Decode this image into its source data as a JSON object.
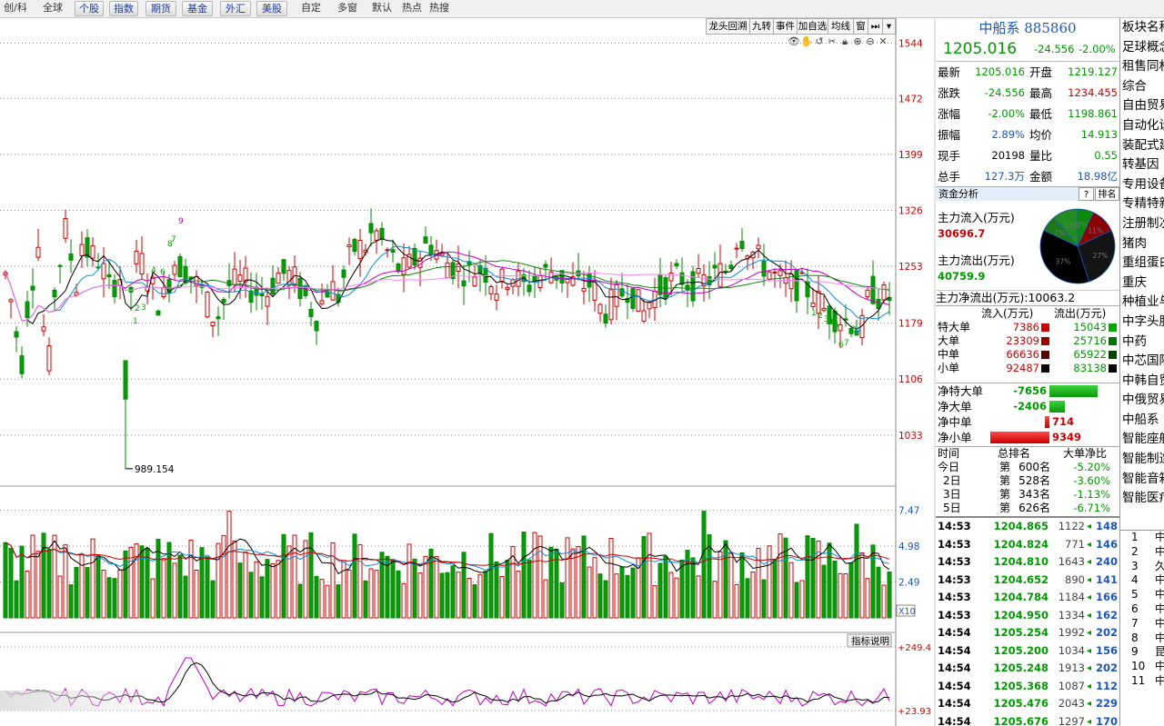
{
  "toolbar": {
    "items": [
      {
        "label": "创/科",
        "style": "plain"
      },
      {
        "label": "全球",
        "style": "plain"
      },
      {
        "label": "个股",
        "style": "btn"
      },
      {
        "label": "指数",
        "style": "btn"
      },
      {
        "label": "期货",
        "style": "btn"
      },
      {
        "label": "基金",
        "style": "btn"
      },
      {
        "label": "外汇",
        "style": "btn"
      },
      {
        "label": "美股",
        "style": "btn"
      },
      {
        "label": "自定",
        "style": "plain"
      },
      {
        "label": "多窗",
        "style": "plain"
      },
      {
        "label": "默认",
        "style": "plain"
      },
      {
        "label": "热点",
        "style": "plain"
      },
      {
        "label": "热搜",
        "style": "plain"
      }
    ]
  },
  "chart_tabs": [
    "龙头回溯",
    "九转",
    "事件",
    "加自选",
    "均线",
    "窗",
    "⏭",
    "▾"
  ],
  "price_axis": [
    "1544",
    "1472",
    "1399",
    "1326",
    "1253",
    "1179",
    "1106",
    "1033"
  ],
  "low_label": "989.154",
  "volume_axis": [
    "7.47",
    "4.98",
    "2.49"
  ],
  "volume_unit": "X10",
  "indicator_axis": [
    "+249.4",
    "+23.93"
  ],
  "indicator_button": "指标说明",
  "td_labels": {
    "l1": [
      "9",
      "8",
      "7",
      "6",
      "4",
      "3",
      "2",
      "1"
    ],
    "l2": [
      "1",
      "2",
      "3",
      "4",
      "5",
      "6",
      "7",
      "8",
      "9"
    ]
  },
  "chart_data": {
    "type": "candlestick",
    "price_ylim": [
      989.154,
      1544
    ],
    "last_close": 1205.016,
    "low": 989.154,
    "series": [
      {
        "name": "MA5",
        "color": "#000000"
      },
      {
        "name": "MA10",
        "color": "#0a8fd8"
      },
      {
        "name": "MA20",
        "color": "#c000c0"
      },
      {
        "name": "MA30",
        "color": "#0a8a0a"
      },
      {
        "name": "MA60",
        "color": "#ff80ff"
      }
    ],
    "volume_ylim": [
      0,
      7.47
    ],
    "indicator_ylim": [
      23.93,
      249.4
    ]
  },
  "quote": {
    "name": "中船系",
    "code": "885860",
    "price": "1205.016",
    "change": "-24.556",
    "pct": "-2.00%",
    "rows": [
      {
        "l": "最新",
        "v": "1205.016",
        "vc": "green",
        "l2": "开盘",
        "v2": "1219.127",
        "v2c": "green"
      },
      {
        "l": "涨跌",
        "v": "-24.556",
        "vc": "green",
        "l2": "最高",
        "v2": "1234.455",
        "v2c": "red"
      },
      {
        "l": "涨幅",
        "v": "-2.00%",
        "vc": "green",
        "l2": "最低",
        "v2": "1198.861",
        "v2c": "green"
      },
      {
        "l": "振幅",
        "v": "2.89%",
        "vc": "blue",
        "l2": "均价",
        "v2": "14.913",
        "v2c": "green"
      },
      {
        "l": "现手",
        "v": "20198",
        "vc": "",
        "l2": "量比",
        "v2": "0.55",
        "v2c": "green"
      },
      {
        "l": "总手",
        "v": "127.3万",
        "vc": "blue",
        "l2": "金额",
        "v2": "18.98亿",
        "v2c": "blue"
      }
    ]
  },
  "fund": {
    "header": "资金分析",
    "help": "?",
    "rank_btn": "排名",
    "inflow_label": "主力流入(万元)",
    "inflow": "30696.7",
    "outflow_label": "主力流出(万元)",
    "outflow": "40759.9",
    "net_label": "主力净流出(万元):",
    "net": "10063.2",
    "pie": [
      {
        "label": "7%",
        "frac": 0.07,
        "color": "#0a8a0a"
      },
      {
        "label": "11%",
        "frac": 0.11,
        "color": "#8b0000"
      },
      {
        "label": "27%",
        "frac": 0.27,
        "color": "#141414"
      },
      {
        "label": "37%",
        "frac": 0.37,
        "color": "#000000"
      },
      {
        "label": "7%",
        "frac": 0.07,
        "color": "#1a7a1a"
      },
      {
        "label": "11%",
        "frac": 0.11,
        "color": "#228b22"
      }
    ]
  },
  "flow_table": {
    "headers": [
      "流入(万元)",
      "流出(万元)"
    ],
    "rows": [
      {
        "name": "特大单",
        "in": "7386",
        "out": "15043",
        "inc": "#cc0000",
        "outc": "#00aa00"
      },
      {
        "name": "大单",
        "in": "23309",
        "out": "25716",
        "inc": "#990000",
        "outc": "#007700"
      },
      {
        "name": "中单",
        "in": "66636",
        "out": "65922",
        "inc": "#550000",
        "outc": "#004400"
      },
      {
        "name": "小单",
        "in": "92487",
        "out": "83138",
        "inc": "#000000",
        "outc": "#000000"
      }
    ]
  },
  "net_bars": [
    {
      "name": "净特大单",
      "val": "-7656",
      "frac": -0.82
    },
    {
      "name": "净大单",
      "val": "-2406",
      "frac": -0.26
    },
    {
      "name": "净中单",
      "val": "714",
      "frac": 0.08
    },
    {
      "name": "净小单",
      "val": "9349",
      "frac": 1.0
    }
  ],
  "rank_table": {
    "headers": [
      "时间",
      "总排名",
      "大单净比"
    ],
    "rows": [
      {
        "t": "今日",
        "pre": "第",
        "n": "600",
        "suf": "名",
        "p": "-5.20%"
      },
      {
        "t": "2日",
        "pre": "第",
        "n": "528",
        "suf": "名",
        "p": "-3.60%"
      },
      {
        "t": "3日",
        "pre": "第",
        "n": "343",
        "suf": "名",
        "p": "-1.13%"
      },
      {
        "t": "5日",
        "pre": "第",
        "n": "626",
        "suf": "名",
        "p": "-6.71%"
      }
    ]
  },
  "ticks": [
    {
      "t": "14:53",
      "p": "1204.865",
      "v": "1122",
      "n": "148"
    },
    {
      "t": "14:53",
      "p": "1204.824",
      "v": "771",
      "n": "146"
    },
    {
      "t": "14:53",
      "p": "1204.810",
      "v": "1643",
      "n": "240"
    },
    {
      "t": "14:53",
      "p": "1204.652",
      "v": "890",
      "n": "141"
    },
    {
      "t": "14:53",
      "p": "1204.784",
      "v": "1184",
      "n": "166"
    },
    {
      "t": "14:53",
      "p": "1204.950",
      "v": "1334",
      "n": "162"
    },
    {
      "t": "14:54",
      "p": "1205.254",
      "v": "1992",
      "n": "202"
    },
    {
      "t": "14:54",
      "p": "1205.200",
      "v": "1034",
      "n": "156"
    },
    {
      "t": "14:54",
      "p": "1205.248",
      "v": "1913",
      "n": "202"
    },
    {
      "t": "14:54",
      "p": "1205.368",
      "v": "1087",
      "n": "112"
    },
    {
      "t": "14:54",
      "p": "1205.476",
      "v": "2043",
      "n": "229"
    },
    {
      "t": "14:54",
      "p": "1205.676",
      "v": "1297",
      "n": "170"
    }
  ],
  "sidebar": {
    "header": "板块名称",
    "items": [
      "足球概念",
      "租售同权",
      "综合",
      "自由贸易",
      "自动化设",
      "装配式建",
      "转基因",
      "专用设备",
      "专精特新",
      "注册制次",
      "猪肉",
      "重组蛋白",
      "重庆",
      "种植业与",
      "中字头股",
      "中药",
      "中芯国际",
      "中韩自贸",
      "中俄贸易",
      "中船系",
      "智能座舱",
      "智能制造",
      "智能音箱",
      "智能医疗"
    ],
    "list": [
      {
        "n": "1",
        "c": "中"
      },
      {
        "n": "2",
        "c": "中"
      },
      {
        "n": "3",
        "c": "久"
      },
      {
        "n": "4",
        "c": "中"
      },
      {
        "n": "5",
        "c": "中"
      },
      {
        "n": "6",
        "c": "中"
      },
      {
        "n": "7",
        "c": "中"
      },
      {
        "n": "8",
        "c": "中"
      },
      {
        "n": "9",
        "c": "昆"
      },
      {
        "n": "10",
        "c": "中"
      },
      {
        "n": "11",
        "c": "中"
      }
    ]
  }
}
